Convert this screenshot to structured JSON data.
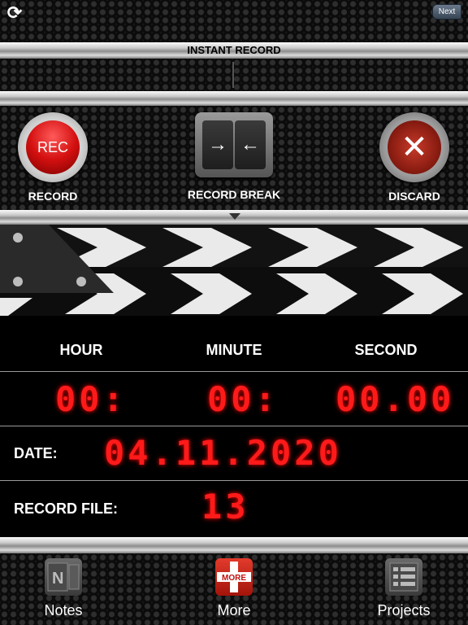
{
  "header": {
    "next_label": "Next",
    "refresh_icon": "refresh-icon"
  },
  "instant_record": {
    "title": "INSTANT RECORD"
  },
  "controls": {
    "record": {
      "button_text": "REC",
      "label": "RECORD"
    },
    "record_break": {
      "label": "RECORD BREAK",
      "left_arrow": "→",
      "right_arrow": "←"
    },
    "discard": {
      "label": "DISCARD",
      "icon": "✕"
    }
  },
  "timer": {
    "headers": {
      "hour": "HOUR",
      "minute": "MINUTE",
      "second": "SECOND"
    },
    "values": {
      "hour": "00:",
      "minute": "00:",
      "second": "00.00"
    },
    "color": "#ff1a1a"
  },
  "date": {
    "label": "DATE:",
    "value": "04.11.2020"
  },
  "record_file": {
    "label": "RECORD FILE:",
    "value": "13"
  },
  "tabs": [
    {
      "label": "Notes",
      "icon": "notes-icon"
    },
    {
      "label": "More",
      "icon": "more-icon",
      "badge": "MORE"
    },
    {
      "label": "Projects",
      "icon": "projects-icon"
    }
  ]
}
